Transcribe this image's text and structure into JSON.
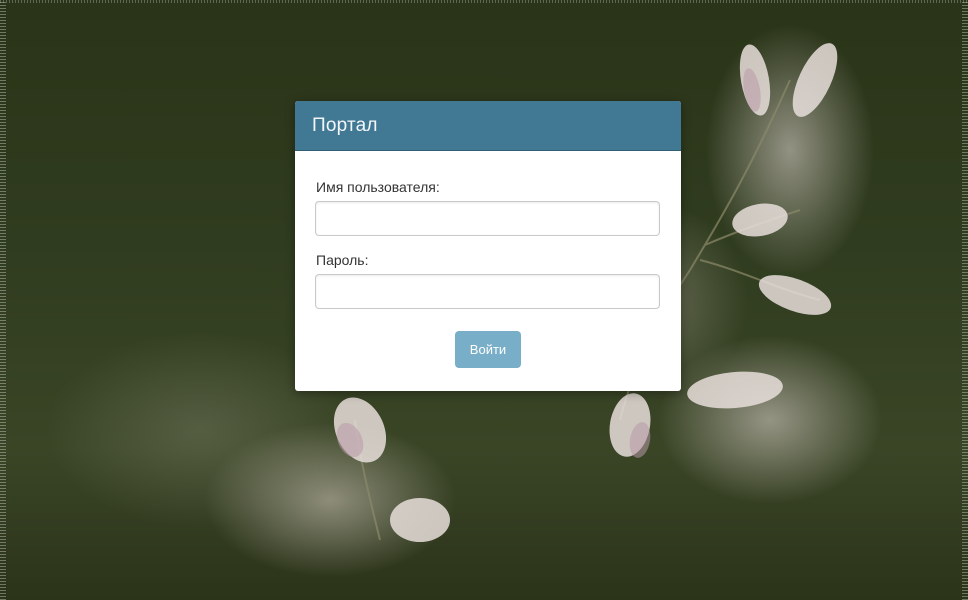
{
  "login": {
    "title": "Портал",
    "username_label": "Имя пользователя:",
    "username_value": "",
    "password_label": "Пароль:",
    "password_value": "",
    "submit_label": "Войти"
  },
  "theme": {
    "header_color": "#417893",
    "button_color": "#79aec8",
    "background_tone": "#2f3b1e"
  }
}
